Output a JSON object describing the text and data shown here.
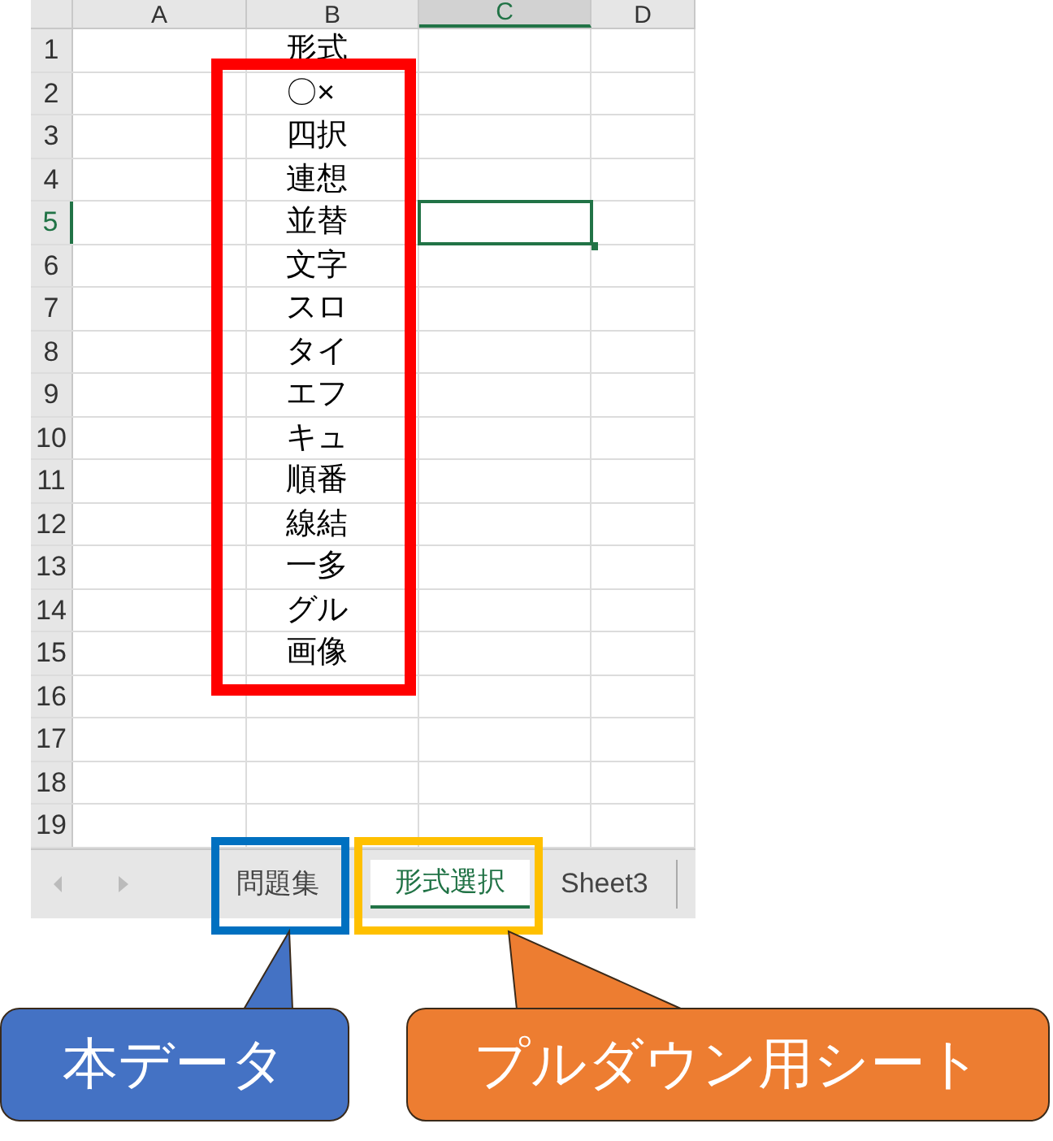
{
  "columns": [
    {
      "label": "A",
      "selected": false
    },
    {
      "label": "B",
      "selected": false
    },
    {
      "label": "C",
      "selected": true
    },
    {
      "label": "D",
      "selected": false
    }
  ],
  "rows": [
    {
      "number": "1",
      "column_b": "形式",
      "selected": false
    },
    {
      "number": "2",
      "column_b": "〇×",
      "selected": false
    },
    {
      "number": "3",
      "column_b": "四択",
      "selected": false
    },
    {
      "number": "4",
      "column_b": "連想",
      "selected": false
    },
    {
      "number": "5",
      "column_b": "並替",
      "selected": true
    },
    {
      "number": "6",
      "column_b": "文字",
      "selected": false
    },
    {
      "number": "7",
      "column_b": "スロ",
      "selected": false
    },
    {
      "number": "8",
      "column_b": "タイ",
      "selected": false
    },
    {
      "number": "9",
      "column_b": "エフ",
      "selected": false
    },
    {
      "number": "10",
      "column_b": "キュ",
      "selected": false
    },
    {
      "number": "11",
      "column_b": "順番",
      "selected": false
    },
    {
      "number": "12",
      "column_b": "線結",
      "selected": false
    },
    {
      "number": "13",
      "column_b": "一多",
      "selected": false
    },
    {
      "number": "14",
      "column_b": "グル",
      "selected": false
    },
    {
      "number": "15",
      "column_b": "画像",
      "selected": false
    },
    {
      "number": "16",
      "selected": false
    },
    {
      "number": "17",
      "selected": false
    },
    {
      "number": "18",
      "selected": false
    },
    {
      "number": "19",
      "selected": false
    }
  ],
  "sheet_tabs": [
    {
      "label": "問題集",
      "selected": false
    },
    {
      "label": "形式選択",
      "selected": true
    },
    {
      "label": "Sheet3",
      "selected": false
    }
  ],
  "highlight_boxes": [
    {
      "color": "#ff0000"
    },
    {
      "color": "#0070c0"
    },
    {
      "color": "#ffc000"
    }
  ],
  "callouts": [
    {
      "text": "本データ",
      "color": "#4472c4"
    },
    {
      "text": "プルダウン用シート",
      "color": "#ed7d31"
    }
  ]
}
